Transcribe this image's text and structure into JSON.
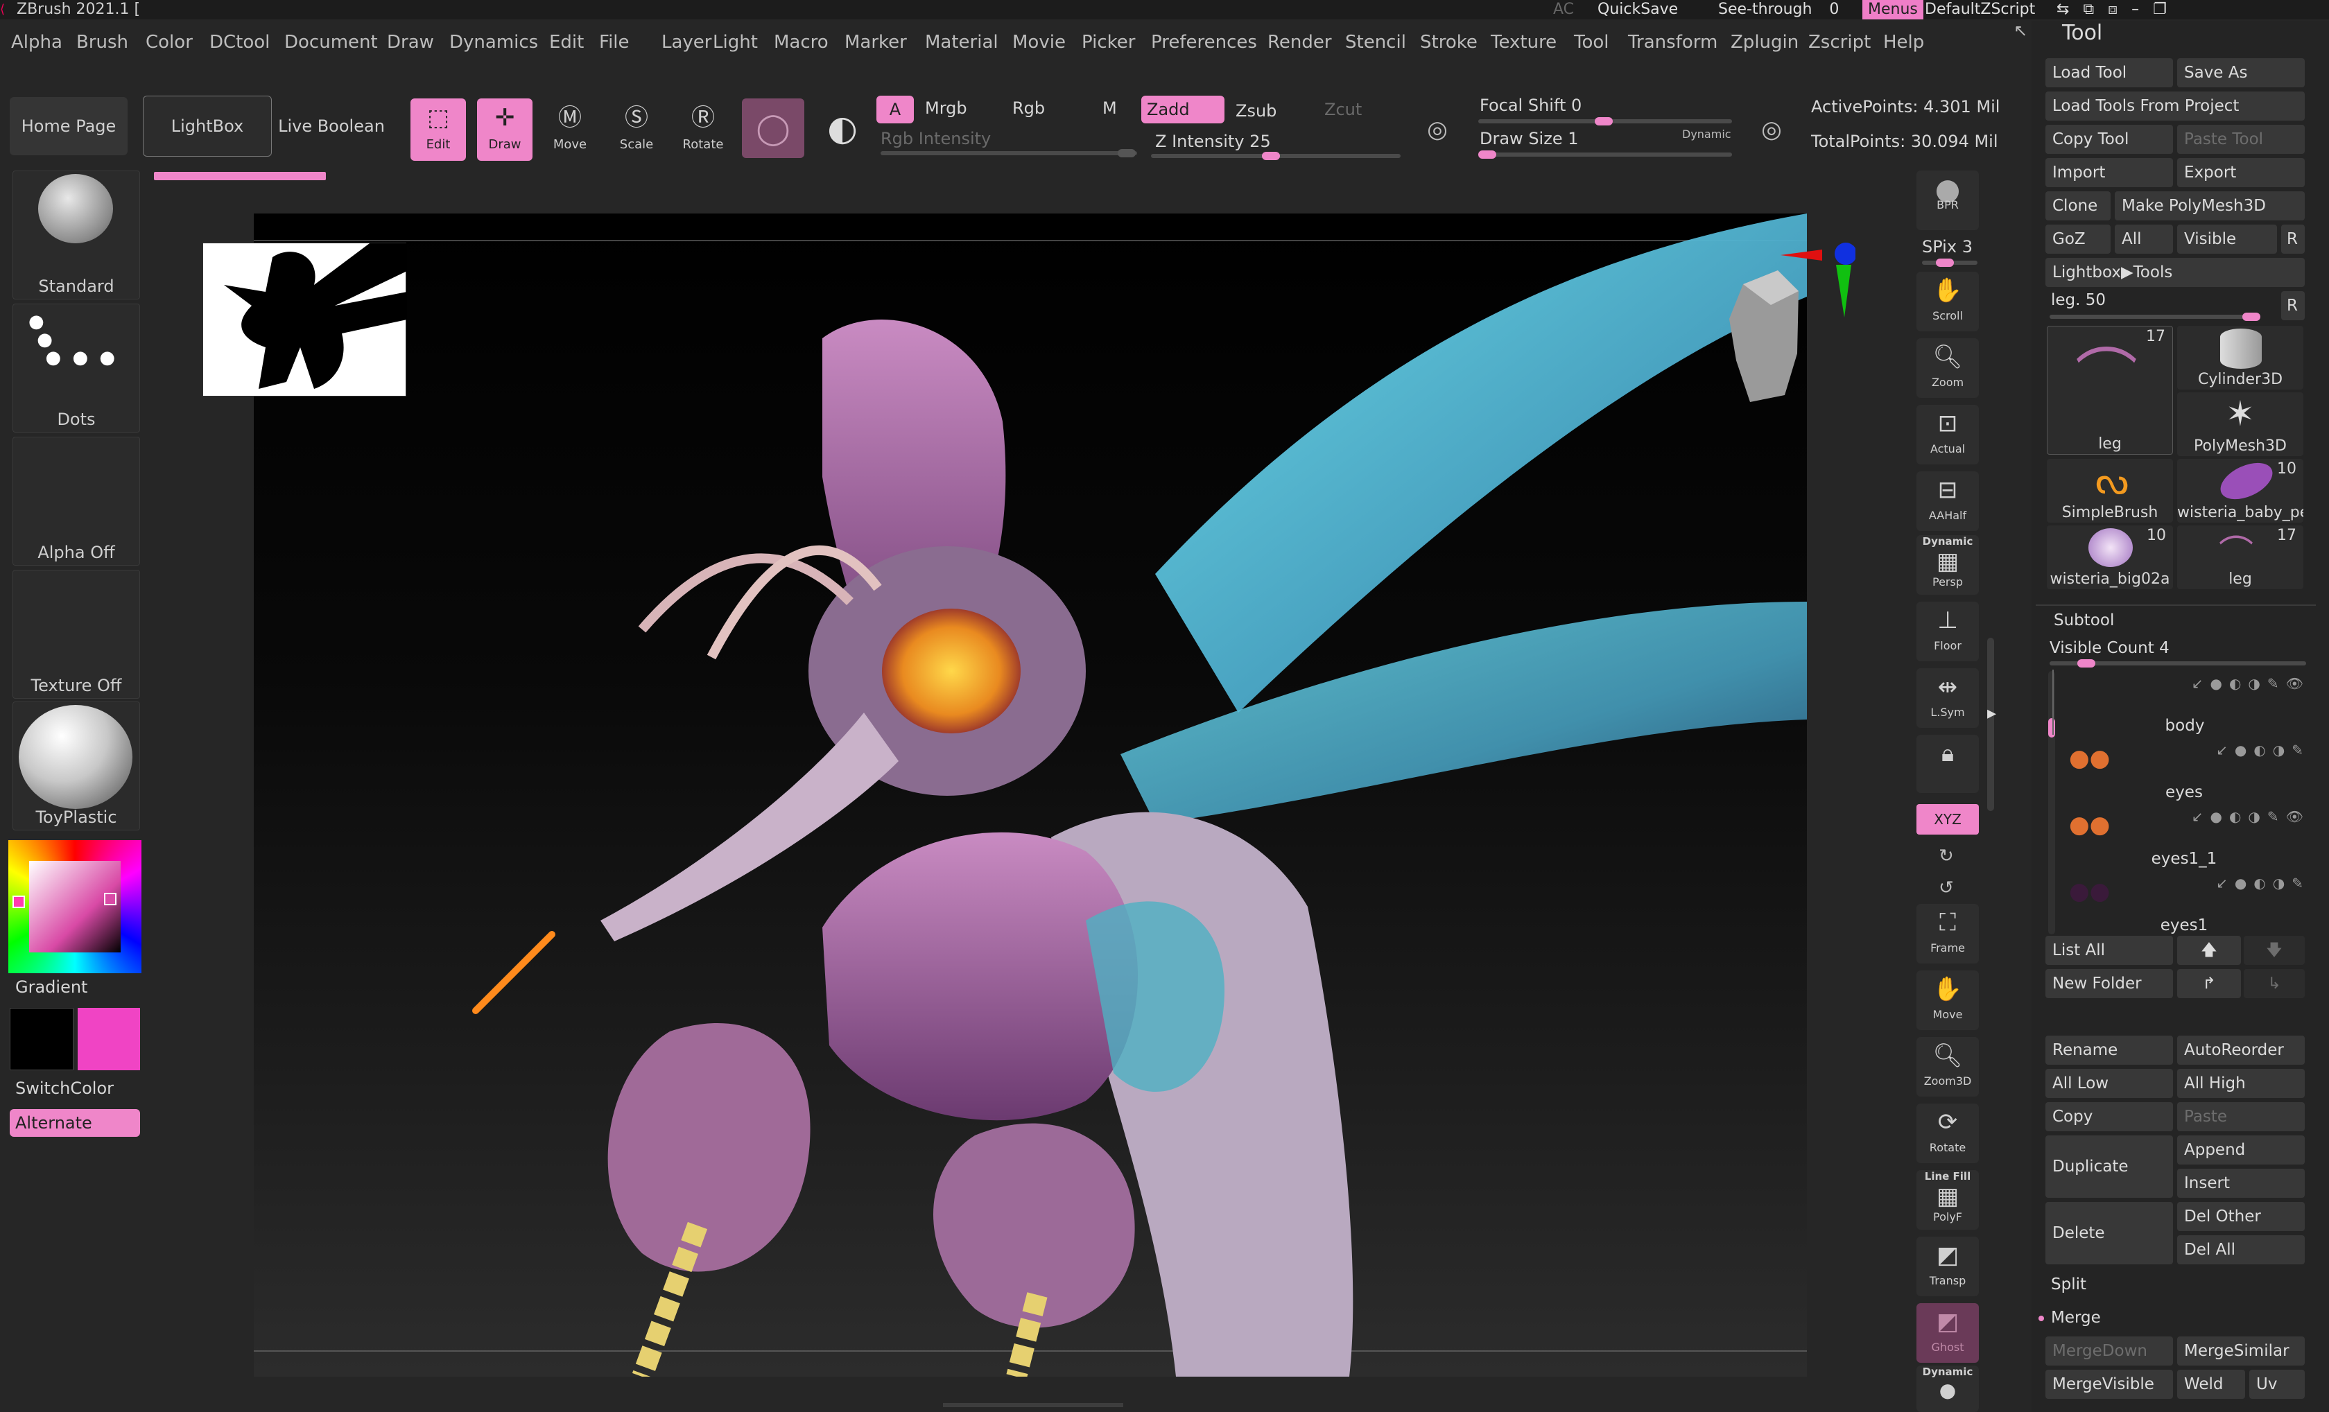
{
  "title_bar": {
    "app_title": "ZBrush 2021.1 [",
    "ac": "AC",
    "quicksave": "QuickSave",
    "see_through": "See-through",
    "see_through_value": "0",
    "menus": "Menus",
    "script": "DefaultZScript"
  },
  "menu_bar": [
    "Alpha",
    "Brush",
    "Color",
    "DCtool",
    "Document",
    "Draw",
    "Dynamics",
    "Edit",
    "File",
    "Layer",
    "Light",
    "Macro",
    "Marker",
    "Material",
    "Movie",
    "Picker",
    "Preferences",
    "Render",
    "Stencil",
    "Stroke",
    "Texture",
    "Tool",
    "Transform",
    "Zplugin",
    "Zscript",
    "Help"
  ],
  "shelf": {
    "home_page": "Home Page",
    "lightbox": "LightBox",
    "live_boolean": "Live Boolean",
    "edit": "Edit",
    "draw": "Draw",
    "move": "Move",
    "scale": "Scale",
    "rotate": "Rotate",
    "a": "A",
    "mrgb": "Mrgb",
    "rgb": "Rgb",
    "m": "M",
    "zadd": "Zadd",
    "zsub": "Zsub",
    "zcut": "Zcut",
    "rgb_intensity": "Rgb Intensity",
    "z_intensity": "Z Intensity",
    "z_intensity_value": "25",
    "focal_shift": "Focal Shift",
    "focal_shift_value": "0",
    "draw_size": "Draw Size",
    "draw_size_value": "1",
    "dynamic": "Dynamic",
    "active_points": "ActivePoints: 4.301 Mil",
    "total_points": "TotalPoints: 30.094 Mil"
  },
  "left_tray": {
    "brush": "Standard",
    "stroke": "Dots",
    "alpha": "Alpha Off",
    "texture": "Texture Off",
    "material": "ToyPlastic",
    "gradient": "Gradient",
    "switch_color": "SwitchColor",
    "alternate": "Alternate",
    "main_color": "#000000",
    "secondary_color": "#f044c4"
  },
  "right_shelf": {
    "bpr": "BPR",
    "spix": "SPix",
    "spix_value": "3",
    "scroll": "Scroll",
    "zoom": "Zoom",
    "actual": "Actual",
    "aahalf": "AAHalf",
    "dynamic": "Dynamic",
    "persp": "Persp",
    "floor": "Floor",
    "lsym": "L.Sym",
    "xyz": "XYZ",
    "frame": "Frame",
    "move": "Move",
    "zoom3d": "Zoom3D",
    "rotate": "Rotate",
    "line_fill": "Line Fill",
    "polyf": "PolyF",
    "transp": "Transp",
    "ghost": "Ghost",
    "solo_dynamic": "Dynamic"
  },
  "tool_panel": {
    "header": "Tool",
    "load_tool": "Load Tool",
    "save_as": "Save As",
    "load_from_project": "Load Tools From Project",
    "copy_tool": "Copy Tool",
    "paste_tool": "Paste Tool",
    "import": "Import",
    "export": "Export",
    "clone": "Clone",
    "make_polymesh": "Make PolyMesh3D",
    "goz": "GoZ",
    "all": "All",
    "visible": "Visible",
    "r": "R",
    "lightbox_tools": "Lightbox▶Tools",
    "leg_slider": "leg.",
    "leg_slider_value": "50",
    "tools": [
      {
        "name": "leg",
        "count": "17"
      },
      {
        "name": "Cylinder3D",
        "count": ""
      },
      {
        "name": "",
        "count": ""
      },
      {
        "name": "PolyMesh3D",
        "count": ""
      },
      {
        "name": "SimpleBrush",
        "count": ""
      },
      {
        "name": "wisteria_baby_pe",
        "count": "10"
      },
      {
        "name": "wisteria_big02a",
        "count": "10"
      },
      {
        "name": "leg",
        "count": "17"
      }
    ],
    "subtool": "Subtool",
    "visible_count": "Visible Count",
    "visible_count_value": "4",
    "subtools": [
      "body",
      "eyes",
      "eyes1_1",
      "eyes1"
    ],
    "list_all": "List All",
    "new_folder": "New Folder",
    "rename": "Rename",
    "autoreorder": "AutoReorder",
    "all_low": "All Low",
    "all_high": "All High",
    "copy": "Copy",
    "paste": "Paste",
    "duplicate": "Duplicate",
    "append": "Append",
    "insert": "Insert",
    "delete": "Delete",
    "del_other": "Del Other",
    "del_all": "Del All",
    "split": "Split",
    "merge": "Merge",
    "merge_down": "MergeDown",
    "merge_similar": "MergeSimilar",
    "merge_visible": "MergeVisible",
    "weld": "Weld",
    "uv": "Uv"
  }
}
